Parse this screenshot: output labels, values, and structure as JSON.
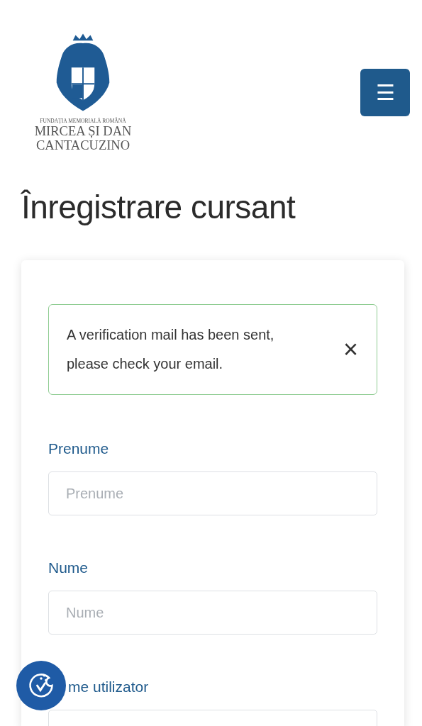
{
  "logo": {
    "tagline": "FUNDAȚIA MEMORIALĂ ROMÂNĂ",
    "name_line_1": "MIRCEA ȘI DAN",
    "name_line_2": "CANTACUZINO"
  },
  "menu_button": {
    "icon": "☰"
  },
  "heading": "Înregistrare cursant",
  "alert": {
    "message": "A verification mail has been sent, please check your email.",
    "close": "×"
  },
  "fields": [
    {
      "label": "Prenume",
      "placeholder": "Prenume"
    },
    {
      "label": "Nume",
      "placeholder": "Nume"
    },
    {
      "label": "me utilizator",
      "partly_hidden": true
    }
  ]
}
